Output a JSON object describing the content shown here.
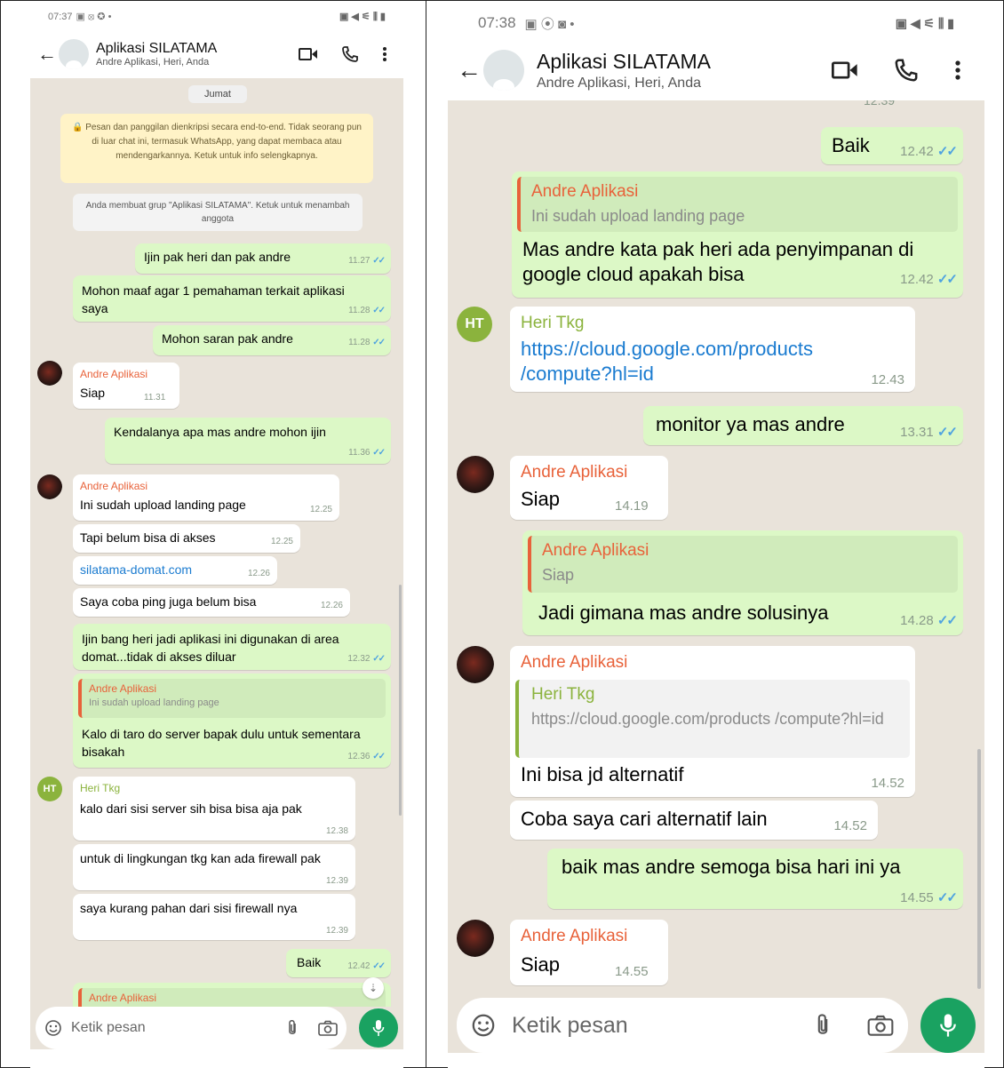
{
  "left": {
    "status": {
      "time": "07:37",
      "icons": "▣ ⦻ ✪ •",
      "right_icons": "▣ ◀ ⚟ ⫼ ▮"
    },
    "header": {
      "title": "Aplikasi SILATAMA",
      "subtitle": "Andre Aplikasi, Heri, Anda"
    },
    "date_label": "Jumat",
    "encryption_notice": "🔒 Pesan dan panggilan dienkripsi secara end-to-end. Tidak seorang pun di luar chat ini, termasuk WhatsApp, yang dapat membaca atau mendengarkannya. Ketuk untuk info selengkapnya.",
    "group_notice": "Anda membuat grup \"Aplikasi SILATAMA\". Ketuk untuk menambah anggota",
    "messages": [
      {
        "text": "Ijin pak heri dan pak andre",
        "time": "11.27"
      },
      {
        "text": "Mohon maaf agar 1 pemahaman terkait aplikasi saya",
        "time": "11.28"
      },
      {
        "text": "Mohon saran pak andre",
        "time": "11.28"
      },
      {
        "sender": "Andre Aplikasi",
        "text": "Siap",
        "time": "11.31"
      },
      {
        "text": "Kendalanya apa mas andre mohon ijin",
        "time": "11.36"
      },
      {
        "sender": "Andre Aplikasi",
        "text": "Ini sudah upload landing page",
        "time": "12.25"
      },
      {
        "text": "Tapi belum bisa di akses",
        "time": "12.25"
      },
      {
        "text": "silatama-domat.com",
        "time": "12.26"
      },
      {
        "text": "Saya coba ping juga belum bisa",
        "time": "12.26"
      },
      {
        "text": "Ijin bang heri jadi aplikasi ini digunakan di area domat...tidak di akses diluar",
        "time": "12.32"
      },
      {
        "quote_sender": "Andre Aplikasi",
        "quote_text": "Ini sudah upload landing page",
        "text": "Kalo di taro do server bapak dulu untuk sementara bisakah",
        "time": "12.36"
      },
      {
        "sender": "Heri Tkg",
        "text": "kalo dari sisi server sih bisa bisa aja pak",
        "time": "12.38"
      },
      {
        "text": "untuk di lingkungan tkg kan ada firewall pak",
        "time": "12.39"
      },
      {
        "text": "saya kurang pahan dari sisi firewall nya",
        "time": "12.39"
      },
      {
        "text": "Baik",
        "time": "12.42"
      },
      {
        "quote_sender": "Andre Aplikasi"
      }
    ],
    "avatar_ht": "HT",
    "input_placeholder": "Ketik pesan"
  },
  "right": {
    "status": {
      "time": "07:38",
      "icons": "▣ ⦿ ◙ •",
      "right_icons": "▣ ◀ ⚟ ⫼ ▮"
    },
    "header": {
      "title": "Aplikasi SILATAMA",
      "subtitle": "Andre Aplikasi, Heri, Anda"
    },
    "cut_time": "12.39",
    "messages": [
      {
        "text": "Baik",
        "time": "12.42"
      },
      {
        "quote_sender": "Andre Aplikasi",
        "quote_text": "Ini sudah upload landing page",
        "text": "Mas andre kata pak heri ada penyimpanan di google cloud apakah bisa",
        "time": "12.42"
      },
      {
        "sender": "Heri Tkg",
        "text": "https://cloud.google.com/products /compute?hl=id",
        "time": "12.43"
      },
      {
        "text": "monitor ya mas andre",
        "time": "13.31"
      },
      {
        "sender": "Andre Aplikasi",
        "text": "Siap",
        "time": "14.19"
      },
      {
        "quote_sender": "Andre Aplikasi",
        "quote_text": "Siap",
        "text": "Jadi gimana mas andre solusinya",
        "time": "14.28"
      },
      {
        "sender": "Andre Aplikasi",
        "quote_sender": "Heri Tkg",
        "quote_text": "https://cloud.google.com/products /compute?hl=id",
        "text": "Ini bisa jd alternatif",
        "time": "14.52"
      },
      {
        "text": "Coba saya cari alternatif lain",
        "time": "14.52"
      },
      {
        "text": "baik mas andre semoga bisa hari ini ya",
        "time": "14.55"
      },
      {
        "sender": "Andre Aplikasi",
        "text": "Siap",
        "time": "14.55"
      }
    ],
    "avatar_ht": "HT",
    "input_placeholder": "Ketik pesan"
  },
  "colors": {
    "outgoing": "#dcf8c6",
    "incoming": "#ffffff",
    "chat_bg": "#e9e3da",
    "accent_green": "#1aa261",
    "sender_andre": "#e8623a",
    "sender_heri": "#8bb33d",
    "tick": "#4fa3e0"
  },
  "icons": [
    "back-arrow-icon",
    "video-call-icon",
    "phone-call-icon",
    "more-vert-icon",
    "emoji-icon",
    "attach-icon",
    "camera-icon",
    "mic-icon",
    "double-check-icon",
    "scroll-down-icon",
    "lock-icon"
  ]
}
